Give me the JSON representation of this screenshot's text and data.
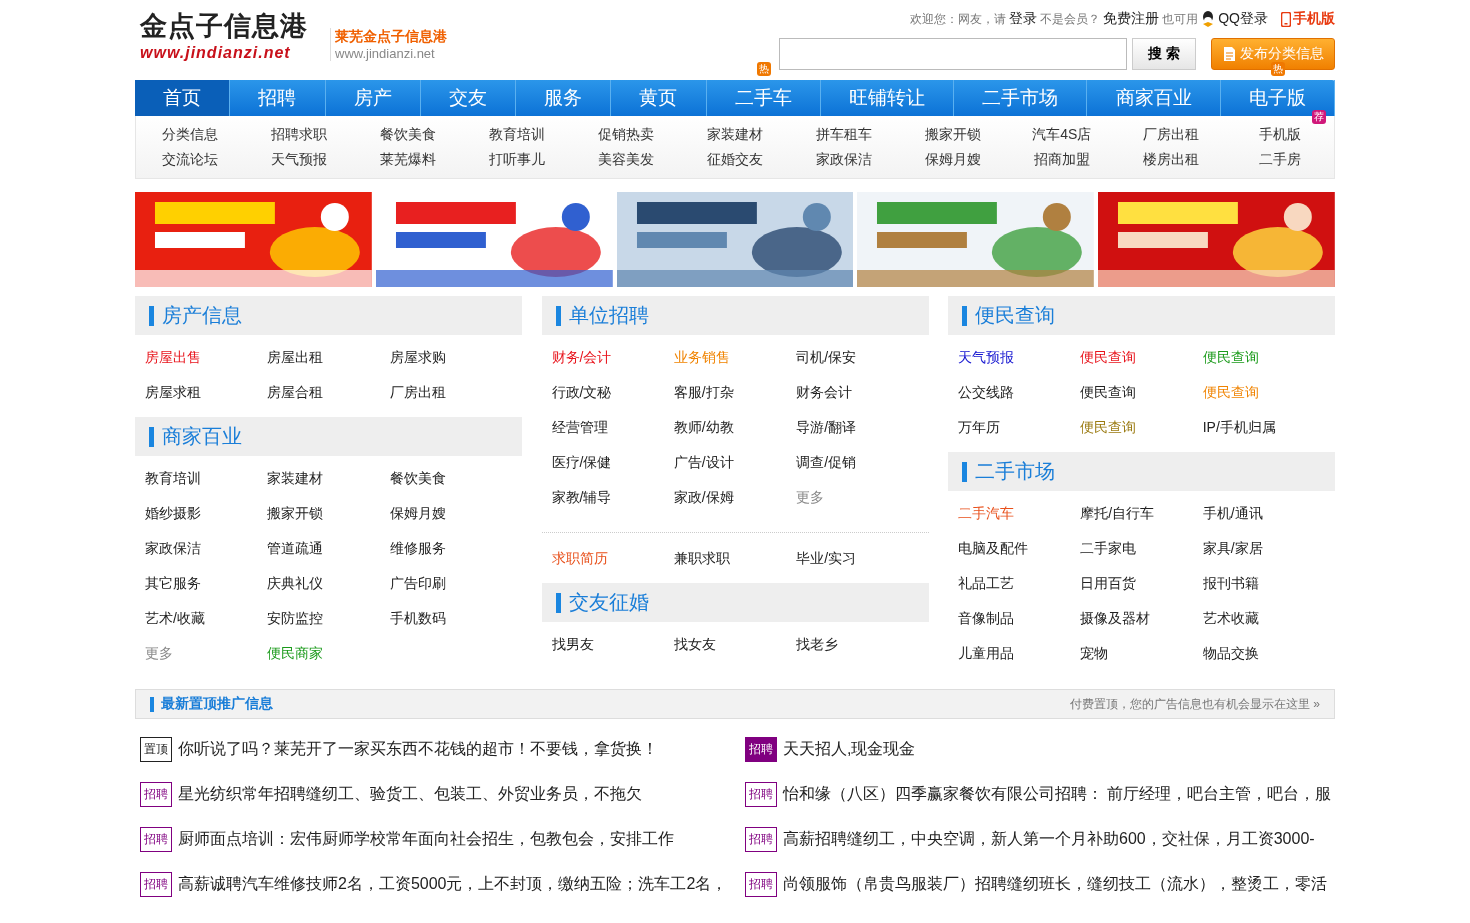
{
  "logo": {
    "name": "金点子信息港",
    "url": "www.jindianzi.net"
  },
  "site": {
    "name": "莱芜金点子信息港",
    "url": "www.jindianzi.net"
  },
  "top_bar": {
    "welcome": "欢迎您：网友，请",
    "login": "登录",
    "not_member": "不是会员？",
    "register": "免费注册",
    "also": "也可用",
    "qq_login": "QQ登录",
    "mobile": "手机版"
  },
  "search": {
    "button": "搜 索"
  },
  "publish_button": "发布分类信息",
  "nav": [
    {
      "label": "首页",
      "selected": true
    },
    {
      "label": "招聘",
      "selected": false
    },
    {
      "label": "房产",
      "selected": false
    },
    {
      "label": "交友",
      "selected": false
    },
    {
      "label": "服务",
      "selected": false
    },
    {
      "label": "黄页",
      "selected": false
    },
    {
      "label": "二手车",
      "selected": false,
      "badge": "热"
    },
    {
      "label": "旺铺转让",
      "selected": false
    },
    {
      "label": "二手市场",
      "selected": false
    },
    {
      "label": "商家百业",
      "selected": false
    },
    {
      "label": "电子版",
      "selected": false,
      "badge": "热"
    }
  ],
  "subnav": [
    {
      "label": "分类信息"
    },
    {
      "label": "招聘求职"
    },
    {
      "label": "餐饮美食"
    },
    {
      "label": "教育培训"
    },
    {
      "label": "促销热卖"
    },
    {
      "label": "家装建材"
    },
    {
      "label": "拼车租车"
    },
    {
      "label": "搬家开锁"
    },
    {
      "label": "汽车4S店"
    },
    {
      "label": "厂房出租"
    },
    {
      "label": "手机版",
      "badge": "荐"
    },
    {
      "label": "交流论坛"
    },
    {
      "label": "天气预报"
    },
    {
      "label": "莱芜爆料"
    },
    {
      "label": "打听事儿"
    },
    {
      "label": "美容美发"
    },
    {
      "label": "征婚交友"
    },
    {
      "label": "家政保洁"
    },
    {
      "label": "保姆月嫂"
    },
    {
      "label": "招商加盟"
    },
    {
      "label": "楼房出租"
    },
    {
      "label": "二手房"
    }
  ],
  "ads": [
    {
      "kind": "picture"
    },
    {
      "kind": "picture"
    },
    {
      "kind": "picture"
    },
    {
      "kind": "picture"
    },
    {
      "kind": "picture"
    }
  ],
  "columns": [
    [
      {
        "kind": "section",
        "title": "房产信息",
        "items": [
          {
            "label": "房屋出售",
            "color": "#e8131b"
          },
          {
            "label": "房屋出租"
          },
          {
            "label": "房屋求购"
          },
          {
            "label": "房屋求租"
          },
          {
            "label": "房屋合租"
          },
          {
            "label": "厂房出租"
          }
        ]
      },
      {
        "kind": "section",
        "title": "商家百业",
        "items": [
          {
            "label": "教育培训"
          },
          {
            "label": "家装建材"
          },
          {
            "label": "餐饮美食"
          },
          {
            "label": "婚纱摄影"
          },
          {
            "label": "搬家开锁"
          },
          {
            "label": "保姆月嫂"
          },
          {
            "label": "家政保洁"
          },
          {
            "label": "管道疏通"
          },
          {
            "label": "维修服务"
          },
          {
            "label": "其它服务"
          },
          {
            "label": "庆典礼仪"
          },
          {
            "label": "广告印刷"
          },
          {
            "label": "艺术/收藏"
          },
          {
            "label": "安防监控"
          },
          {
            "label": "手机数码"
          },
          {
            "label": "更多",
            "color": "#888888"
          },
          {
            "label": "便民商家",
            "color": "#1a9a1a"
          }
        ]
      }
    ],
    [
      {
        "kind": "section",
        "title": "单位招聘",
        "items": [
          {
            "label": "财务/会计",
            "color": "#e8131b"
          },
          {
            "label": "业务销售",
            "color": "#f08300"
          },
          {
            "label": "司机/保安"
          },
          {
            "label": "行政/文秘"
          },
          {
            "label": "客服/打杂"
          },
          {
            "label": "财务会计"
          },
          {
            "label": "经营管理"
          },
          {
            "label": "教师/幼教"
          },
          {
            "label": "导游/翻译"
          },
          {
            "label": "医疗/保健"
          },
          {
            "label": "广告/设计"
          },
          {
            "label": "调查/促销"
          },
          {
            "label": "家教/辅导"
          },
          {
            "label": "家政/保姆"
          },
          {
            "label": "更多",
            "color": "#888888"
          }
        ]
      },
      {
        "kind": "divided",
        "items": [
          {
            "label": "求职简历",
            "color": "#e8501b"
          },
          {
            "label": "兼职求职"
          },
          {
            "label": "毕业/实习"
          }
        ]
      },
      {
        "kind": "section",
        "title": "交友征婚",
        "items": [
          {
            "label": "找男友"
          },
          {
            "label": "找女友"
          },
          {
            "label": "找老乡"
          }
        ]
      }
    ],
    [
      {
        "kind": "section",
        "title": "便民查询",
        "items": [
          {
            "label": "天气预报",
            "color": "#1515d0"
          },
          {
            "label": "便民查询",
            "color": "#e8131b"
          },
          {
            "label": "便民查询",
            "color": "#1a9a1a"
          },
          {
            "label": "公交线路"
          },
          {
            "label": "便民查询"
          },
          {
            "label": "便民查询",
            "color": "#f08300"
          },
          {
            "label": "万年历"
          },
          {
            "label": "便民查询",
            "color": "#9a7a10"
          },
          {
            "label": "IP/手机归属"
          }
        ]
      },
      {
        "kind": "section",
        "title": "二手市场",
        "items": [
          {
            "label": "二手汽车",
            "color": "#e8501b"
          },
          {
            "label": "摩托/自行车"
          },
          {
            "label": "手机/通讯"
          },
          {
            "label": "电脑及配件"
          },
          {
            "label": "二手家电"
          },
          {
            "label": "家具/家居"
          },
          {
            "label": "礼品工艺"
          },
          {
            "label": "日用百货"
          },
          {
            "label": "报刊书籍"
          },
          {
            "label": "音像制品"
          },
          {
            "label": "摄像及器材"
          },
          {
            "label": "艺术收藏"
          },
          {
            "label": "儿童用品"
          },
          {
            "label": "宠物"
          },
          {
            "label": "物品交换"
          }
        ]
      }
    ]
  ],
  "promo": {
    "title": "最新置顶推广信息",
    "note": "付费置顶，您的广告信息也有机会显示在这里 »",
    "items": [
      {
        "tag": "置顶",
        "kind": "outline",
        "color": "#222222",
        "text": "你听说了吗？莱芜开了一家买东西不花钱的超市！不要钱，拿货换！"
      },
      {
        "tag": "招聘",
        "kind": "filled",
        "color": "#800080",
        "text": "天天招人,现金现金"
      },
      {
        "tag": "招聘",
        "kind": "outline",
        "color": "#800080",
        "text": "星光纺织常年招聘缝纫工、验货工、包装工、外贸业务员，不拖欠"
      },
      {
        "tag": "招聘",
        "kind": "outline",
        "color": "#800080",
        "text": "怡和缘（八区）四季赢家餐饮有限公司招聘： 前厅经理，吧台主管，吧台，服"
      },
      {
        "tag": "招聘",
        "kind": "outline",
        "color": "#800080",
        "text": "厨师面点培训：宏伟厨师学校常年面向社会招生，包教包会，安排工作"
      },
      {
        "tag": "招聘",
        "kind": "outline",
        "color": "#800080",
        "text": "高薪招聘缝纫工，中央空调，新人第一个月补助600，交社保，月工资3000-"
      },
      {
        "tag": "招聘",
        "kind": "outline",
        "color": "#800080",
        "text": "高薪诚聘汽车维修技师2名，工资5000元，上不封顶，缴纳五险；洗车工2名，"
      },
      {
        "tag": "招聘",
        "kind": "outline",
        "color": "#800080",
        "text": "尚领服饰（帛贵鸟服装厂）招聘缝纫班长，缝纫技工（流水），整烫工，零活"
      }
    ]
  }
}
